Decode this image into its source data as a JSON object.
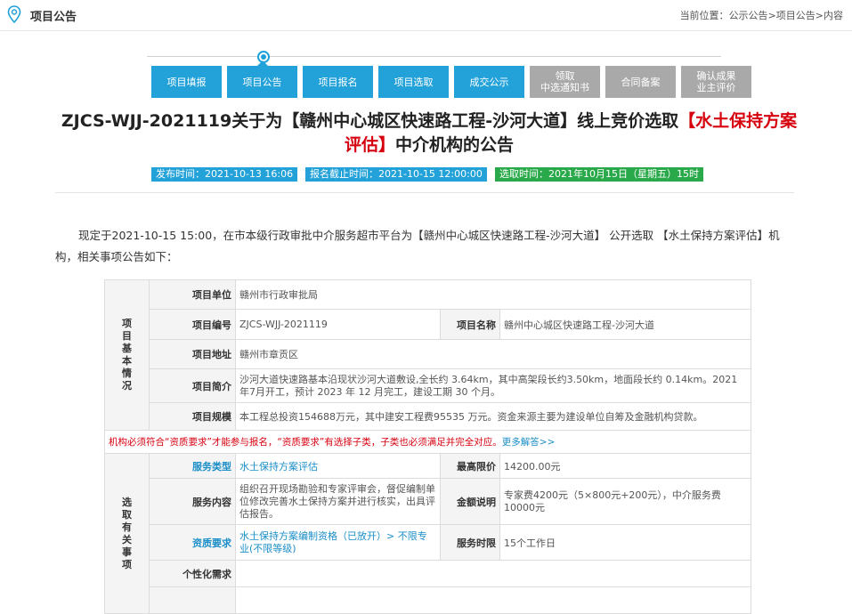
{
  "header": {
    "title": "项目公告",
    "location_label": "当前位置：",
    "crumbs": [
      "公示公告",
      "项目公告",
      "内容"
    ],
    "crumb_sep": ">"
  },
  "steps": [
    {
      "label": "项目填报",
      "state": "done"
    },
    {
      "label": "项目公告",
      "state": "current"
    },
    {
      "label": "项目报名",
      "state": "done"
    },
    {
      "label": "项目选取",
      "state": "done"
    },
    {
      "label": "成交公示",
      "state": "done"
    },
    {
      "label_lines": [
        "领取",
        "中选通知书"
      ],
      "state": "pending"
    },
    {
      "label": "合同备案",
      "state": "pending"
    },
    {
      "label_lines": [
        "确认成果",
        "业主评价"
      ],
      "state": "pending"
    }
  ],
  "announcement": {
    "title_part1": "ZJCS-WJJ-2021119关于为【赣州中心城区快速路工程-沙河大道】线上竞价选取",
    "title_highlight": "【水土保持方案评估】",
    "title_part2": "中介机构的公告",
    "times": {
      "publish_label": "发布时间：",
      "publish": "2021-10-13 16:06",
      "deadline_label": "报名截止时间：",
      "deadline": "2021-10-15 12:00:00",
      "select_label": "选取时间：",
      "select": "2021年10月15日（星期五）15时"
    },
    "intro": "现定于2021-10-15 15:00，在市本级行政审批中介服务超市平台为【赣州中心城区快速路工程-沙河大道】 公开选取 【水土保持方案评估】机构，相关事项公告如下："
  },
  "basic": {
    "section_label": "项目基本情况",
    "owner_label": "项目单位",
    "owner": "赣州市行政审批局",
    "code_label": "项目编号",
    "code": "ZJCS-WJJ-2021119",
    "name_label": "项目名称",
    "name": "赣州中心城区快速路工程-沙河大道",
    "address_label": "项目地址",
    "address": "赣州市章贡区",
    "intro_label": "项目简介",
    "intro": "沙河大道快速路基本沿现状沙河大道敷设,全长约 3.64km，其中高架段长约3.50km，地面段长约 0.14km。2021年7月开工，预计 2023 年 12 月完工，建设工期 30 个月。",
    "scale_label": "项目规模",
    "scale": "本工程总投资154688万元，其中建安工程费95535 万元。资金来源主要为建设单位自筹及金融机构贷款。"
  },
  "notice": {
    "text": "机构必须符合“资质要求”才能参与报名，“资质要求”有选择子类，子类也必须满足并完全对应。",
    "more": "更多解答>>"
  },
  "selection": {
    "section_label": "选取有关事项",
    "service_type_label": "服务类型",
    "service_type": "水土保持方案评估",
    "max_price_label": "最高限价",
    "max_price": "14200.00元",
    "content_label": "服务内容",
    "content": "组织召开现场勘验和专家评审会，督促编制单位修改完善水土保持方案并进行核实，出具评估报告。",
    "amount_label": "金额说明",
    "amount": "专家费4200元（5×800元+200元），中介服务费10000元",
    "qualification_label": "资质要求",
    "qualification": "水土保持方案编制资格（已放开）> 不限专业(不限等级)",
    "duration_label": "服务时限",
    "duration": "15个工作日",
    "custom_label": "个性化需求",
    "custom": ""
  },
  "colors": {
    "accent_blue": "#22a2d8",
    "pending_grey": "#a9a9a9",
    "highlight_red": "#d6000f",
    "select_green": "#2aa94a"
  }
}
